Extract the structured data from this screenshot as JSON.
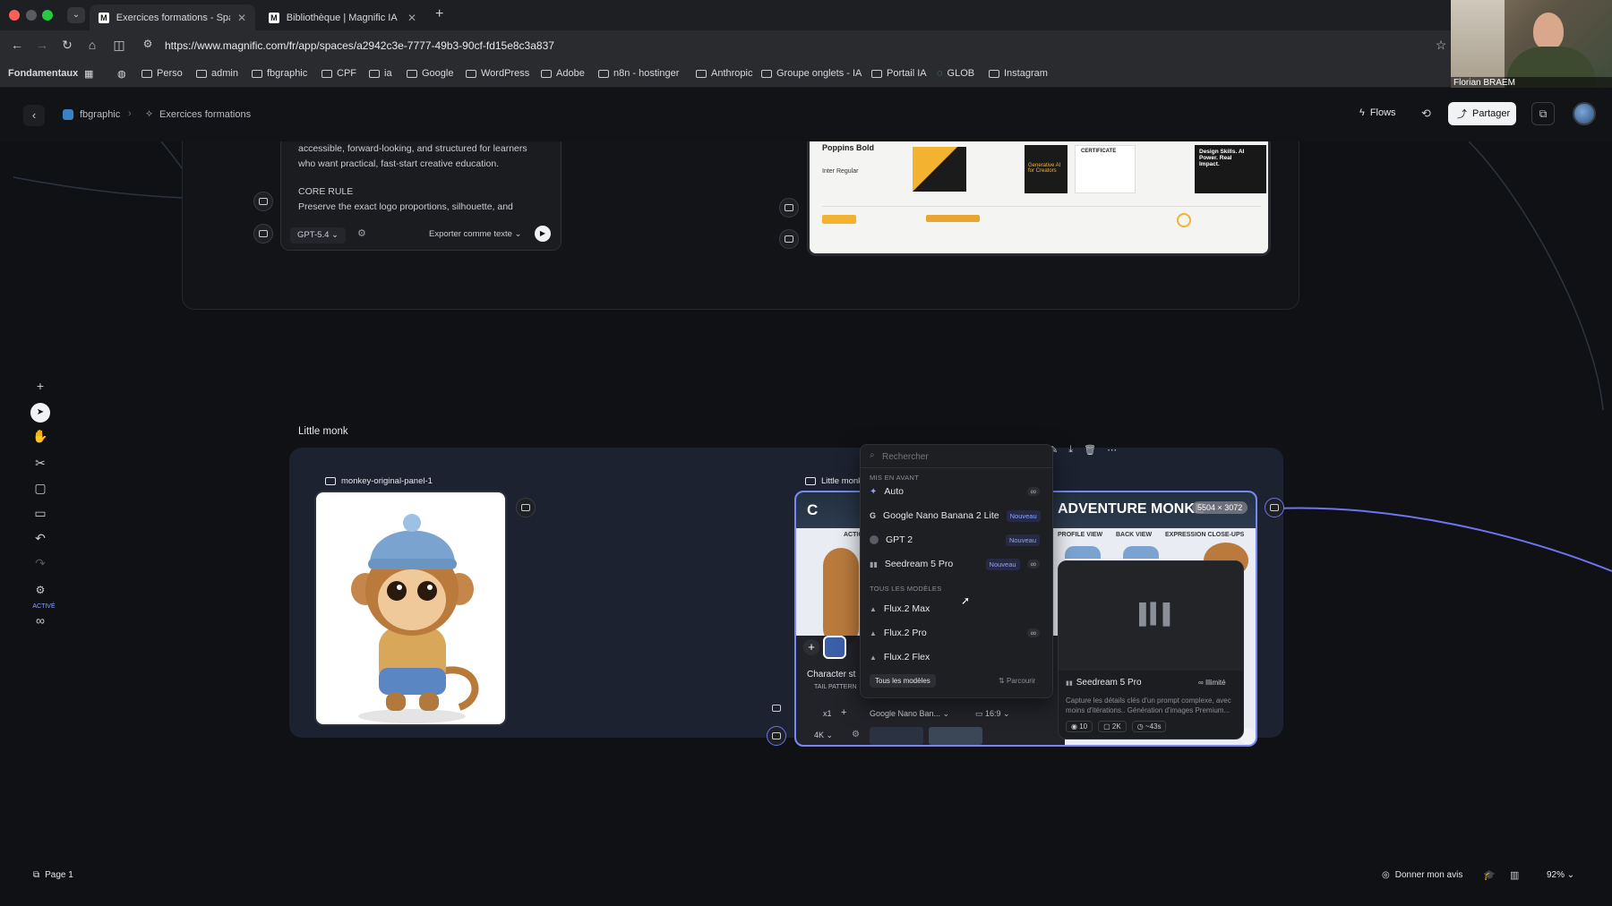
{
  "browser": {
    "tabs": [
      {
        "label": "Exercices formations - Space",
        "active": true
      },
      {
        "label": "Bibliothèque | Magnific IA",
        "active": false
      }
    ],
    "url": "https://www.magnific.com/fr/app/spaces/a2942c3e-7777-49b3-90cf-fd15e8c3a837",
    "bookmarks": [
      "Fondamentaux",
      "Perso",
      "admin",
      "fbgraphic",
      "CPF",
      "ia",
      "Google",
      "WordPress",
      "Adobe",
      "n8n - hostinger",
      "Anthropic",
      "Groupe onglets - IA",
      "Portail IA",
      "GLOB",
      "Instagram"
    ],
    "webcam_name": "Florian BRAEM"
  },
  "app": {
    "breadcrumb": [
      "fbgraphic",
      "Exercices formations"
    ],
    "flows_label": "Flows",
    "share_label": "Partager"
  },
  "top_node": {
    "text_lines": [
      "accessible, forward-looking, and structured for learners",
      "who want practical, fast-start creative education.",
      "CORE RULE",
      "Preserve the exact logo proportions, silhouette, and"
    ],
    "model": "GPT-5.4",
    "export_label": "Exporter comme texte"
  },
  "preview_node": {
    "font_heading": "Poppins Bold",
    "font_body": "Inter Regular",
    "cert_text": "CERTIFICATE",
    "gen_ai_text": "Generative AI for Creators",
    "design_text": "Design Skills. AI Power. Real Impact."
  },
  "group": {
    "title": "Little monk",
    "panel1_label": "monkey-original-panel-1",
    "panel2_label": "Little monk",
    "sheet_title": "ADVENTURE MONKE",
    "sheet_size": "5504 × 3072",
    "sheet_cols": [
      "ACTIO",
      "PROFILE VIEW",
      "BACK VIEW",
      "EXPRESSION CLOSE-UPS"
    ],
    "char_label": "Character st",
    "tail_label": "TAIL PATTERN",
    "multiplier": "x1",
    "resolution": "4K",
    "model_select": "Google Nano Ban...",
    "ratio": "16:9"
  },
  "model_menu": {
    "search_placeholder": "Rechercher",
    "section_featured": "MIS EN AVANT",
    "featured": [
      {
        "name": "Auto",
        "badge": "",
        "infinite": true
      },
      {
        "name": "Google Nano Banana 2 Lite",
        "badge": "Nouveau",
        "infinite": false
      },
      {
        "name": "GPT 2",
        "badge": "Nouveau",
        "infinite": false
      },
      {
        "name": "Seedream 5 Pro",
        "badge": "Nouveau",
        "infinite": true
      }
    ],
    "section_all": "TOUS LES MODÈLES",
    "all": [
      {
        "name": "Flux.2 Max",
        "infinite": false
      },
      {
        "name": "Flux.2 Pro",
        "infinite": true
      },
      {
        "name": "Flux.2 Flex",
        "infinite": false
      }
    ],
    "all_models_button": "Tous les modèles",
    "browse_button": "Parcourir"
  },
  "model_preview": {
    "name": "Seedream 5 Pro",
    "tag": "Illimité",
    "description": "Capture les détails clés d'un prompt complexe, avec moins d'itérations.. Génération d'images Premium...",
    "stats": [
      "10",
      "2K",
      "~43s"
    ]
  },
  "sidebar_tools": {
    "active_label": "ACTIVÉ"
  },
  "footer": {
    "page_label": "Page 1",
    "feedback_label": "Donner mon avis",
    "zoom": "92%"
  },
  "colors": {
    "accent": "#6d74f0",
    "node_bg": "#1b1c20",
    "group_bg": "#1c2230",
    "selection": "#7a86f5"
  }
}
